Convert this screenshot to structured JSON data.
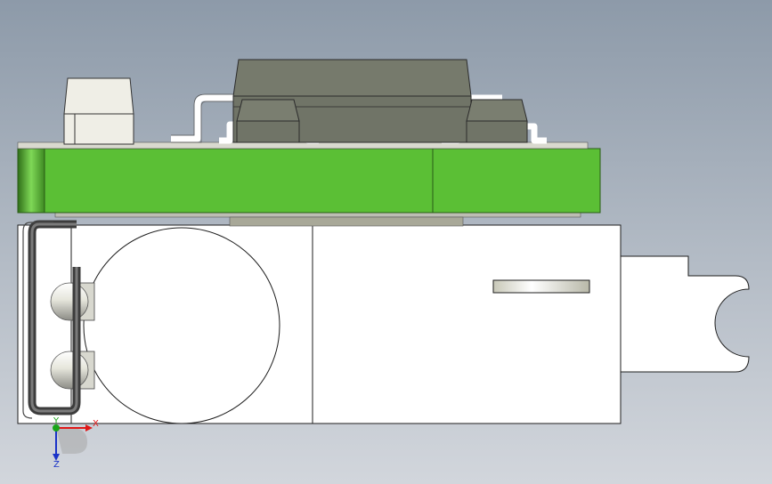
{
  "viewport": {
    "background_top": "#8d9aa9",
    "background_bottom": "#d2d6dc"
  },
  "model": {
    "pcb_color": "#5bbf35",
    "pcb_dark": "#3f8a22",
    "chip_color": "#707467",
    "chip_outline": "#2b2b2b",
    "lead_color": "#ffffff",
    "housing_color": "#ffffff",
    "connector_color": "#efeee6"
  },
  "triad": {
    "x_label": "X",
    "y_label": "Y",
    "z_label": "Z",
    "x_color": "#e01818",
    "y_color": "#19a519",
    "z_color": "#1a33c8"
  },
  "icons": {
    "triad": "coordinate-triad-icon"
  }
}
